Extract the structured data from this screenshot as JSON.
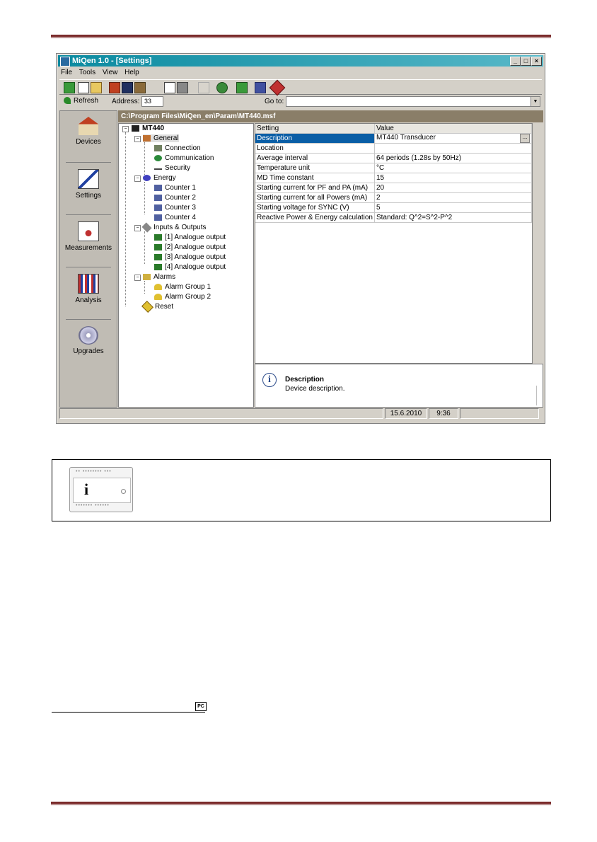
{
  "window": {
    "title": "MiQen 1.0 - [Settings]",
    "controls": [
      "_",
      "□",
      "×"
    ]
  },
  "menu": [
    "File",
    "Tools",
    "View",
    "Help"
  ],
  "addressbar": {
    "refresh_label": "Refresh",
    "address_label": "Address:",
    "address_value": "33",
    "goto_label": "Go to:",
    "goto_value": ""
  },
  "sidebar": {
    "items": [
      {
        "label": "Devices",
        "icon": "house-devices-icon"
      },
      {
        "label": "Settings",
        "icon": "settings-tools-icon"
      },
      {
        "label": "Measurements",
        "icon": "measurements-gauge-icon"
      },
      {
        "label": "Analysis",
        "icon": "analysis-chart-icon"
      },
      {
        "label": "Upgrades",
        "icon": "cd-upgrades-icon"
      }
    ]
  },
  "path": "C:\\Program Files\\MiQen_en\\Param\\MT440.msf",
  "tree": {
    "root": "MT440",
    "general": "General",
    "connection": "Connection",
    "communication": "Communication",
    "security": "Security",
    "energy": "Energy",
    "counter1": "Counter 1",
    "counter2": "Counter 2",
    "counter3": "Counter 3",
    "counter4": "Counter 4",
    "io": "Inputs & Outputs",
    "ao1": "[1] Analogue output",
    "ao2": "[2] Analogue output",
    "ao3": "[3] Analogue output",
    "ao4": "[4] Analogue output",
    "alarms": "Alarms",
    "ag1": "Alarm Group 1",
    "ag2": "Alarm Group 2",
    "reset": "Reset"
  },
  "grid": {
    "headers": {
      "setting": "Setting",
      "value": "Value"
    },
    "rows": [
      {
        "setting": "Description",
        "value": "MT440 Transducer"
      },
      {
        "setting": "Location",
        "value": ""
      },
      {
        "setting": "Average interval",
        "value": "64 periods (1.28s by 50Hz)"
      },
      {
        "setting": "Temperature unit",
        "value": "°C"
      },
      {
        "setting": "MD Time constant",
        "value": "15"
      },
      {
        "setting": "Starting current for PF and PA (mA)",
        "value": "20"
      },
      {
        "setting": "Starting current for all Powers (mA)",
        "value": "2"
      },
      {
        "setting": "Starting voltage for SYNC (V)",
        "value": "5"
      },
      {
        "setting": "Reactive Power & Energy calculation",
        "value": "Standard: Q^2=S^2-P^2"
      }
    ],
    "ellipsis": "..."
  },
  "description": {
    "title": "Description",
    "text": "Device description."
  },
  "statusbar": {
    "date": "15.6.2010",
    "time": "9:36"
  },
  "infobox": {
    "device_letter": "i"
  },
  "footnote_icon": "PC",
  "colors": {
    "title_bar": "#0a8aa0",
    "selection": "#0a5ea6",
    "path_bar": "#8a7e68",
    "rule": "#7a2a2a"
  }
}
